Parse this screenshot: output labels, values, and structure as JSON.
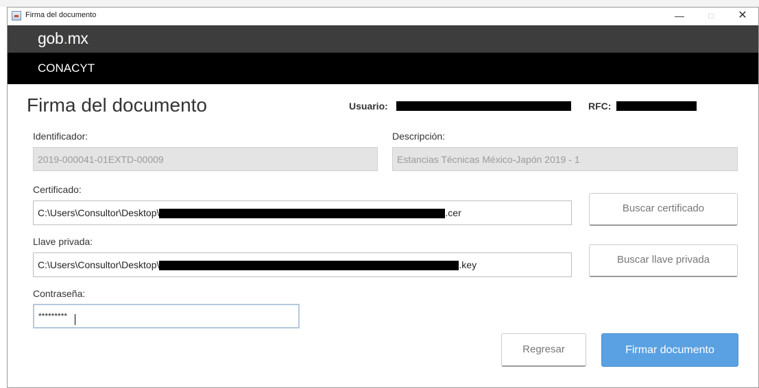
{
  "window": {
    "title": "Firma del documento",
    "controls": {
      "minimize": "—",
      "maximize": "□",
      "close": "✕"
    }
  },
  "header": {
    "brand_main": "gob",
    "brand_dot": ".",
    "brand_suffix": "mx",
    "org": "CONACYT"
  },
  "form": {
    "title": "Firma del documento",
    "usuario_label": "Usuario:",
    "rfc_label": "RFC:",
    "identificador_label": "Identificador:",
    "identificador_value": "2019-000041-01EXTD-00009",
    "descripcion_label": "Descripción:",
    "descripcion_value": "Estancias Técnicas México-Japón 2019 - 1",
    "certificado_label": "Certificado:",
    "certificado_prefix": "C:\\Users\\Consultor\\Desktop\\",
    "certificado_suffix": ".cer",
    "llave_label": "Llave privada:",
    "llave_prefix": "C:\\Users\\Consultor\\Desktop\\",
    "llave_suffix": ".key",
    "password_label": "Contraseña:",
    "password_value": "*********"
  },
  "buttons": {
    "buscar_certificado": "Buscar certificado",
    "buscar_llave": "Buscar llave privada",
    "regresar": "Regresar",
    "firmar": "Firmar documento"
  },
  "colors": {
    "brand_bar": "#3d3d3d",
    "org_bar": "#000000",
    "primary_button": "#5aa1e3"
  }
}
